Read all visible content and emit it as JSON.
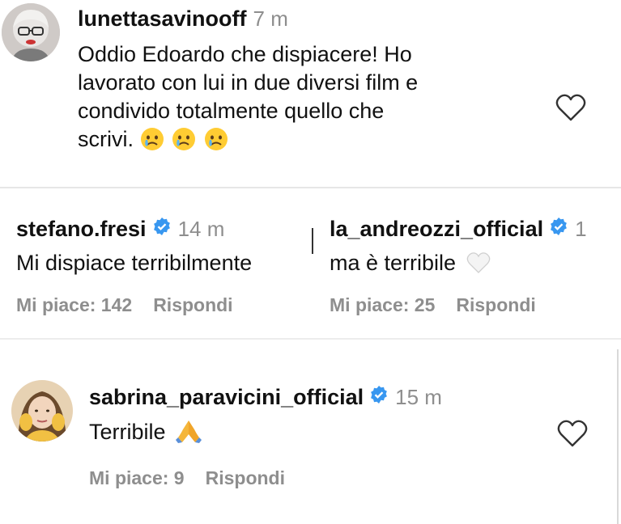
{
  "comments": [
    {
      "username": "lunettasavinooff",
      "time": "7 m",
      "text_lines": [
        "Oddio Edoardo che dispiacere! Ho",
        "lavorato con lui in due diversi film e",
        "condivido totalmente quello che",
        "scrivi."
      ],
      "emojis": [
        "crying-face",
        "crying-face",
        "crying-face"
      ]
    },
    {
      "username": "stefano.fresi",
      "verified": true,
      "time": "14 m",
      "text": "Mi dispiace terribilmente",
      "likes_label": "Mi piace: 142",
      "reply_label": "Rispondi"
    },
    {
      "username": "la_andreozzi_official",
      "verified": true,
      "time": "1",
      "text": "ma è terribile",
      "emoji": "white-heart",
      "likes_label": "Mi piace: 25",
      "reply_label": "Rispondi"
    },
    {
      "username": "sabrina_paravicini_official",
      "verified": true,
      "time": "15 m",
      "text": "Terribile",
      "emoji": "folded-hands",
      "likes_label": "Mi piace: 9",
      "reply_label": "Rispondi"
    }
  ],
  "colors": {
    "verified": "#3897f0",
    "muted": "#8e8e8e",
    "text": "#111111"
  }
}
